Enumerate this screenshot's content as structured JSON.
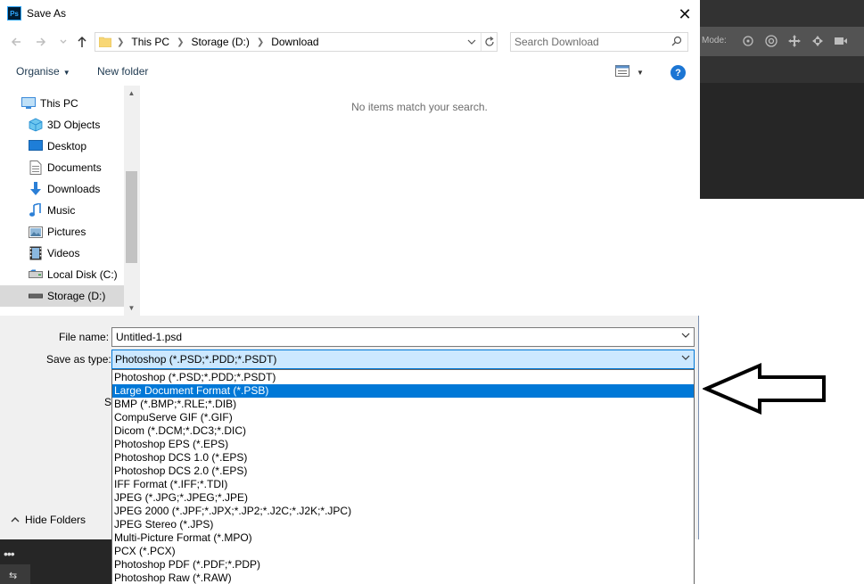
{
  "dialog": {
    "title": "Save As",
    "close": "✕",
    "address_crumbs": [
      "This PC",
      "Storage (D:)",
      "Download"
    ],
    "search_placeholder": "Search Download",
    "toolbar": {
      "organise": "Organise",
      "new_folder": "New folder",
      "help": "?"
    },
    "nav_items": [
      {
        "label": "This PC",
        "icon": "computer-icon"
      },
      {
        "label": "3D Objects",
        "icon": "cube-icon"
      },
      {
        "label": "Desktop",
        "icon": "desktop-icon"
      },
      {
        "label": "Documents",
        "icon": "document-icon"
      },
      {
        "label": "Downloads",
        "icon": "download-icon"
      },
      {
        "label": "Music",
        "icon": "music-icon"
      },
      {
        "label": "Pictures",
        "icon": "picture-icon"
      },
      {
        "label": "Videos",
        "icon": "video-icon"
      },
      {
        "label": "Local Disk (C:)",
        "icon": "drive-icon"
      },
      {
        "label": "Storage (D:)",
        "icon": "drive-icon",
        "selected": true
      }
    ],
    "empty_message": "No items match your search.",
    "file_name_label": "File name:",
    "file_name_value": "Untitled-1.psd",
    "save_as_type_label": "Save as type:",
    "save_as_type_value": "Photoshop (*.PSD;*.PDD;*.PSDT)",
    "hidden_label": "S",
    "hide_folders": "Hide Folders",
    "type_options": [
      "Photoshop (*.PSD;*.PDD;*.PSDT)",
      "Large Document Format (*.PSB)",
      "BMP (*.BMP;*.RLE;*.DIB)",
      "CompuServe GIF (*.GIF)",
      "Dicom (*.DCM;*.DC3;*.DIC)",
      "Photoshop EPS (*.EPS)",
      "Photoshop DCS 1.0 (*.EPS)",
      "Photoshop DCS 2.0 (*.EPS)",
      "IFF Format (*.IFF;*.TDI)",
      "JPEG (*.JPG;*.JPEG;*.JPE)",
      "JPEG 2000 (*.JPF;*.JPX;*.JP2;*.J2C;*.J2K;*.JPC)",
      "JPEG Stereo (*.JPS)",
      "Multi-Picture Format (*.MPO)",
      "PCX (*.PCX)",
      "Photoshop PDF (*.PDF;*.PDP)",
      "Photoshop Raw (*.RAW)"
    ],
    "selected_type_index": 1
  },
  "photoshop_bg": {
    "mode_label": "Mode:"
  },
  "colors": {
    "accent": "#0078d7",
    "ps_dark": "#323232",
    "ps_panel": "#535353"
  }
}
